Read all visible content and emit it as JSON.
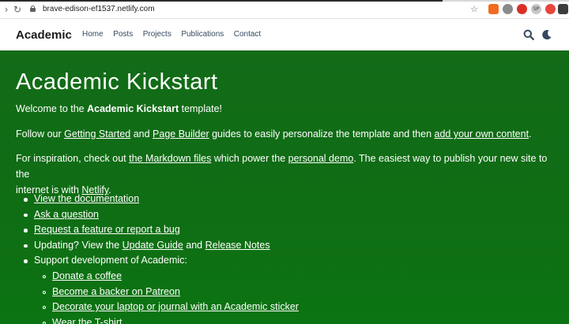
{
  "browser": {
    "url": "brave-edison-ef1537.netlify.com",
    "back_icon": "arrow-right-icon",
    "reload_icon": "reload-icon",
    "extensions": [
      "star-icon",
      "brave-lion-icon",
      "extension-icon",
      "extension-icon",
      "extension-icon",
      "extension-icon",
      "extension-icon"
    ],
    "ext_badge": "SP"
  },
  "navbar": {
    "brand": "Academic",
    "menu": [
      "Home",
      "Posts",
      "Projects",
      "Publications",
      "Contact"
    ],
    "search_icon": "search-icon",
    "theme_icon": "moon-icon"
  },
  "hero": {
    "bg_color": "#0f6d14",
    "title": "Academic Kickstart",
    "welcome_pre": "Welcome to the ",
    "welcome_bold": "Academic Kickstart",
    "welcome_post": " template!",
    "follow": {
      "t1": "Follow our ",
      "l1": "Getting Started",
      "t2": " and ",
      "l2": "Page Builder",
      "t3": " guides to easily personalize the template and then ",
      "l3": "add your own content",
      "t4": "."
    },
    "inspiration": {
      "t1": "For inspiration, check out ",
      "l1": "the Markdown files",
      "t2": " which power the ",
      "l2": "personal demo",
      "t3": ". The easiest way to publish your new site to the",
      "t4": "internet is with ",
      "l3": "Netlify",
      "t5": "."
    },
    "list": {
      "docs": "View the documentation",
      "ask": "Ask a question",
      "request": "Request a feature or report a bug",
      "updating_pre": "Updating? View the ",
      "update_guide": "Update Guide",
      "and": " and ",
      "release_notes": "Release Notes",
      "support": "Support development of Academic:",
      "sub": [
        "Donate a coffee",
        "Become a backer on Patreon",
        "Decorate your laptop or journal with an Academic sticker",
        "Wear the T-shirt"
      ]
    }
  }
}
